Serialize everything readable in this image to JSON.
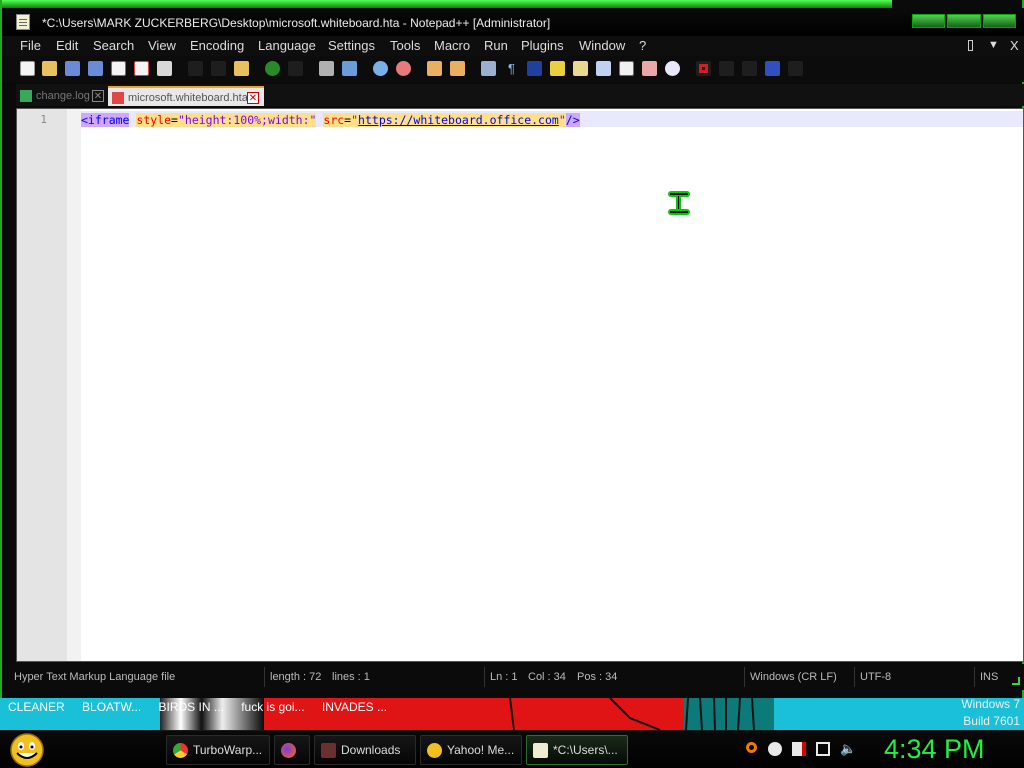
{
  "window": {
    "title": "*C:\\Users\\MARK ZUCKERBERG\\Desktop\\microsoft.whiteboard.hta - Notepad++ [Administrator]"
  },
  "menu": {
    "items": [
      "File",
      "Edit",
      "Search",
      "View",
      "Encoding",
      "Language",
      "Settings",
      "Tools",
      "Macro",
      "Run",
      "Plugins",
      "Window",
      "?"
    ],
    "right_arrow": "▼",
    "right_close": "X"
  },
  "tabs": [
    {
      "label": "change.log",
      "active": false
    },
    {
      "label": "microsoft.whiteboard.hta",
      "active": true
    }
  ],
  "editor": {
    "line_number": "1",
    "code": {
      "tag_open": "<iframe",
      "attr_style": "style",
      "eq1": "=",
      "style_value": "\"height:100%;width:\"",
      "attr_src": "src",
      "eq2": "=",
      "q1": "\"",
      "url": "https://whiteboard.office.com",
      "q2": "\"",
      "tag_close": "/>"
    }
  },
  "status": {
    "file_type": "Hyper Text Markup Language file",
    "length": "length : 72",
    "lines": "lines : 1",
    "ln": "Ln : 1",
    "col": "Col : 34",
    "pos": "Pos : 34",
    "eol": "Windows (CR LF)",
    "encoding": "UTF-8",
    "mode": "INS"
  },
  "wallpaper": {
    "ticker": [
      "CLEANER",
      "BLOATW...",
      "BIRDS IN ...",
      "fuck is goi...",
      "INVADES ..."
    ],
    "os_name": "Windows 7",
    "build": "Build 7601"
  },
  "taskbar": {
    "buttons": [
      {
        "label": "TurboWarp...",
        "icon": "chrome-icon"
      },
      {
        "label": "",
        "icon": "firefox-icon"
      },
      {
        "label": "Downloads",
        "icon": "folder-icon"
      },
      {
        "label": "Yahoo! Me...",
        "icon": "yahoo-messenger-icon"
      },
      {
        "label": "*C:\\Users\\...",
        "icon": "notepadpp-icon"
      }
    ],
    "clock": "4:34 PM"
  },
  "colors": {
    "accent": "#22ee44",
    "tag_bg": "#cfa8ff",
    "attr_bg": "#ffe08a"
  }
}
